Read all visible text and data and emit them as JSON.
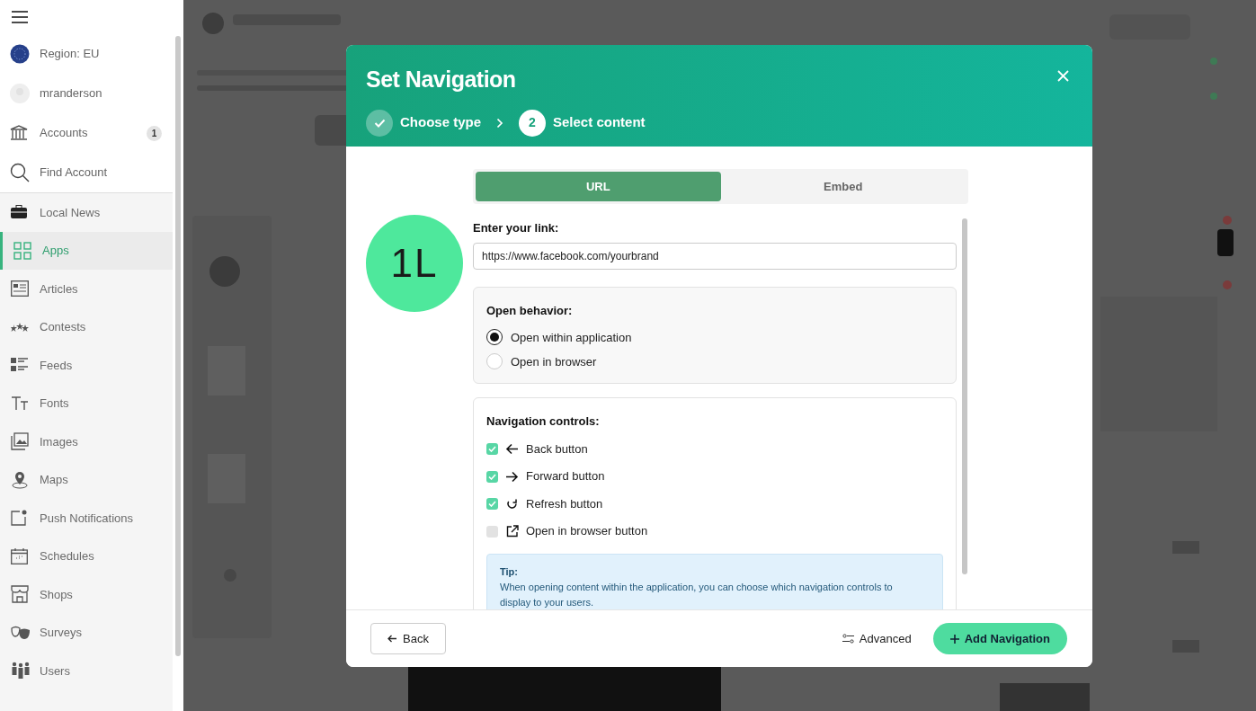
{
  "sidebar": {
    "account_items": [
      {
        "kind": "region",
        "label": "Region: EU"
      },
      {
        "kind": "user",
        "label": "mranderson"
      },
      {
        "kind": "accounts",
        "label": "Accounts",
        "badge": "1"
      },
      {
        "kind": "search",
        "label": "Find Account"
      }
    ],
    "app_items": [
      {
        "label": "Local News",
        "selected": false
      },
      {
        "label": "Apps",
        "selected": true
      },
      {
        "label": "Articles",
        "selected": false
      },
      {
        "label": "Contests",
        "selected": false
      },
      {
        "label": "Feeds",
        "selected": false
      },
      {
        "label": "Fonts",
        "selected": false
      },
      {
        "label": "Images",
        "selected": false
      },
      {
        "label": "Maps",
        "selected": false
      },
      {
        "label": "Push Notifications",
        "selected": false
      },
      {
        "label": "Schedules",
        "selected": false
      },
      {
        "label": "Shops",
        "selected": false
      },
      {
        "label": "Surveys",
        "selected": false
      },
      {
        "label": "Users",
        "selected": false
      }
    ]
  },
  "modal": {
    "title": "Set Navigation",
    "steps": [
      {
        "label": "Choose type",
        "done": true
      },
      {
        "label": "Select content",
        "done": false,
        "number": "2"
      }
    ],
    "avatar": {
      "initials": "1L"
    },
    "tabs": [
      {
        "label": "URL",
        "selected": true
      },
      {
        "label": "Embed",
        "selected": false
      }
    ],
    "link_field": {
      "label": "Enter your link:",
      "value": "https://www.facebook.com/yourbrand"
    },
    "open_behavior": {
      "title": "Open behavior:",
      "options": [
        {
          "label": "Open within application",
          "selected": true
        },
        {
          "label": "Open in browser",
          "selected": false
        }
      ]
    },
    "navigation_controls": {
      "title": "Navigation controls:",
      "items": [
        {
          "kind": "back",
          "label": "Back button",
          "checked": true
        },
        {
          "kind": "forward",
          "label": "Forward button",
          "checked": true
        },
        {
          "kind": "refresh",
          "label": "Refresh button",
          "checked": true
        },
        {
          "kind": "external",
          "label": "Open in browser button",
          "checked": false
        }
      ]
    },
    "tip": {
      "title": "Tip:",
      "text": "When opening content within the application, you can choose which navigation controls to display to your users."
    },
    "footer": {
      "back": "Back",
      "advanced": "Advanced",
      "primary": "Add Navigation"
    }
  }
}
